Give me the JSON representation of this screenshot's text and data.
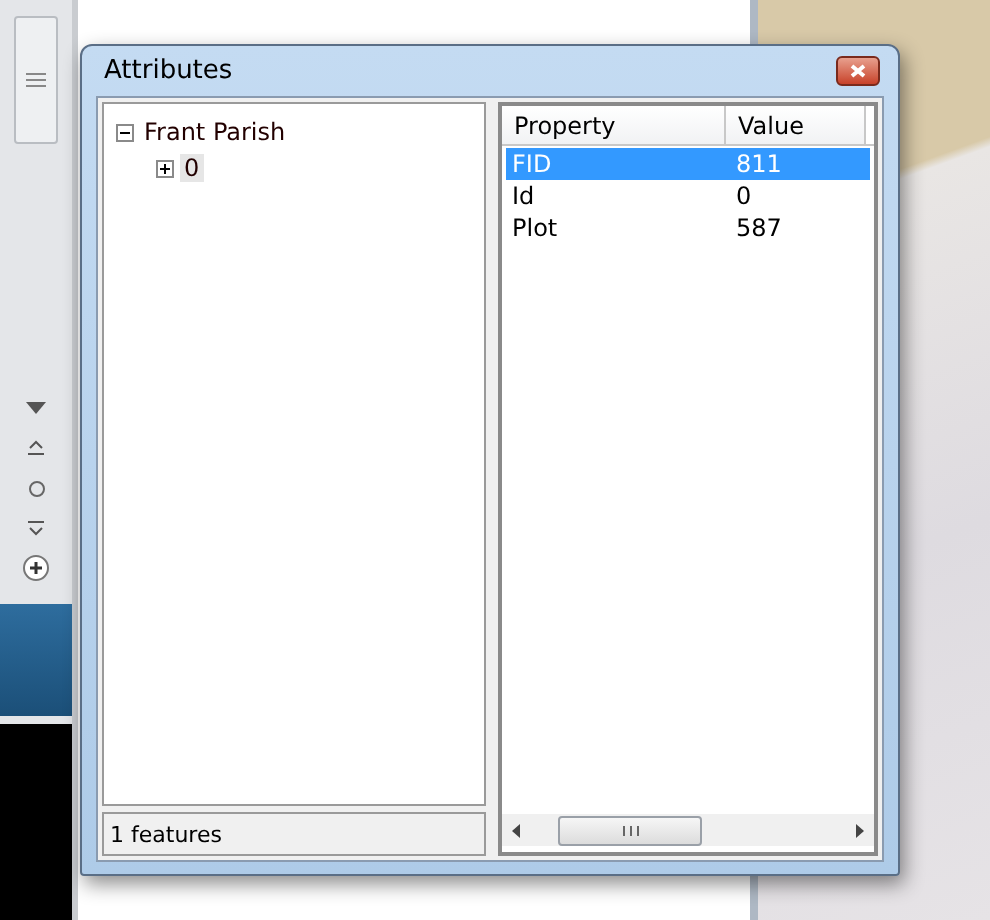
{
  "window": {
    "title": "Attributes"
  },
  "tree": [
    {
      "label": "Frant Parish",
      "expanded": true,
      "selected": false,
      "children": [
        {
          "label": "0",
          "expanded": false,
          "selected": true
        }
      ]
    }
  ],
  "status": "1 features",
  "table": {
    "columns": [
      "Property",
      "Value"
    ],
    "rows": [
      {
        "cells": [
          "FID",
          "811"
        ],
        "selected": true
      },
      {
        "cells": [
          "Id",
          "0"
        ],
        "selected": false
      },
      {
        "cells": [
          "Plot",
          "587"
        ],
        "selected": false
      }
    ]
  }
}
